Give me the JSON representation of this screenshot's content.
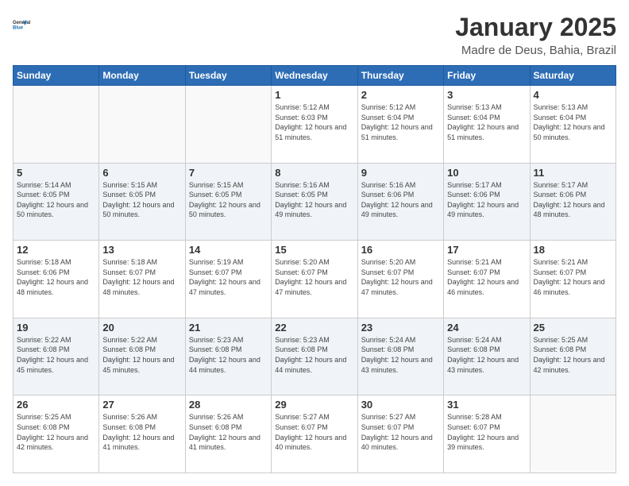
{
  "logo": {
    "line1": "General",
    "line2": "Blue"
  },
  "calendar": {
    "title": "January 2025",
    "subtitle": "Madre de Deus, Bahia, Brazil"
  },
  "headers": [
    "Sunday",
    "Monday",
    "Tuesday",
    "Wednesday",
    "Thursday",
    "Friday",
    "Saturday"
  ],
  "weeks": [
    {
      "shaded": false,
      "days": [
        {
          "num": "",
          "info": ""
        },
        {
          "num": "",
          "info": ""
        },
        {
          "num": "",
          "info": ""
        },
        {
          "num": "1",
          "info": "Sunrise: 5:12 AM\nSunset: 6:03 PM\nDaylight: 12 hours\nand 51 minutes."
        },
        {
          "num": "2",
          "info": "Sunrise: 5:12 AM\nSunset: 6:04 PM\nDaylight: 12 hours\nand 51 minutes."
        },
        {
          "num": "3",
          "info": "Sunrise: 5:13 AM\nSunset: 6:04 PM\nDaylight: 12 hours\nand 51 minutes."
        },
        {
          "num": "4",
          "info": "Sunrise: 5:13 AM\nSunset: 6:04 PM\nDaylight: 12 hours\nand 50 minutes."
        }
      ]
    },
    {
      "shaded": true,
      "days": [
        {
          "num": "5",
          "info": "Sunrise: 5:14 AM\nSunset: 6:05 PM\nDaylight: 12 hours\nand 50 minutes."
        },
        {
          "num": "6",
          "info": "Sunrise: 5:15 AM\nSunset: 6:05 PM\nDaylight: 12 hours\nand 50 minutes."
        },
        {
          "num": "7",
          "info": "Sunrise: 5:15 AM\nSunset: 6:05 PM\nDaylight: 12 hours\nand 50 minutes."
        },
        {
          "num": "8",
          "info": "Sunrise: 5:16 AM\nSunset: 6:05 PM\nDaylight: 12 hours\nand 49 minutes."
        },
        {
          "num": "9",
          "info": "Sunrise: 5:16 AM\nSunset: 6:06 PM\nDaylight: 12 hours\nand 49 minutes."
        },
        {
          "num": "10",
          "info": "Sunrise: 5:17 AM\nSunset: 6:06 PM\nDaylight: 12 hours\nand 49 minutes."
        },
        {
          "num": "11",
          "info": "Sunrise: 5:17 AM\nSunset: 6:06 PM\nDaylight: 12 hours\nand 48 minutes."
        }
      ]
    },
    {
      "shaded": false,
      "days": [
        {
          "num": "12",
          "info": "Sunrise: 5:18 AM\nSunset: 6:06 PM\nDaylight: 12 hours\nand 48 minutes."
        },
        {
          "num": "13",
          "info": "Sunrise: 5:18 AM\nSunset: 6:07 PM\nDaylight: 12 hours\nand 48 minutes."
        },
        {
          "num": "14",
          "info": "Sunrise: 5:19 AM\nSunset: 6:07 PM\nDaylight: 12 hours\nand 47 minutes."
        },
        {
          "num": "15",
          "info": "Sunrise: 5:20 AM\nSunset: 6:07 PM\nDaylight: 12 hours\nand 47 minutes."
        },
        {
          "num": "16",
          "info": "Sunrise: 5:20 AM\nSunset: 6:07 PM\nDaylight: 12 hours\nand 47 minutes."
        },
        {
          "num": "17",
          "info": "Sunrise: 5:21 AM\nSunset: 6:07 PM\nDaylight: 12 hours\nand 46 minutes."
        },
        {
          "num": "18",
          "info": "Sunrise: 5:21 AM\nSunset: 6:07 PM\nDaylight: 12 hours\nand 46 minutes."
        }
      ]
    },
    {
      "shaded": true,
      "days": [
        {
          "num": "19",
          "info": "Sunrise: 5:22 AM\nSunset: 6:08 PM\nDaylight: 12 hours\nand 45 minutes."
        },
        {
          "num": "20",
          "info": "Sunrise: 5:22 AM\nSunset: 6:08 PM\nDaylight: 12 hours\nand 45 minutes."
        },
        {
          "num": "21",
          "info": "Sunrise: 5:23 AM\nSunset: 6:08 PM\nDaylight: 12 hours\nand 44 minutes."
        },
        {
          "num": "22",
          "info": "Sunrise: 5:23 AM\nSunset: 6:08 PM\nDaylight: 12 hours\nand 44 minutes."
        },
        {
          "num": "23",
          "info": "Sunrise: 5:24 AM\nSunset: 6:08 PM\nDaylight: 12 hours\nand 43 minutes."
        },
        {
          "num": "24",
          "info": "Sunrise: 5:24 AM\nSunset: 6:08 PM\nDaylight: 12 hours\nand 43 minutes."
        },
        {
          "num": "25",
          "info": "Sunrise: 5:25 AM\nSunset: 6:08 PM\nDaylight: 12 hours\nand 42 minutes."
        }
      ]
    },
    {
      "shaded": false,
      "days": [
        {
          "num": "26",
          "info": "Sunrise: 5:25 AM\nSunset: 6:08 PM\nDaylight: 12 hours\nand 42 minutes."
        },
        {
          "num": "27",
          "info": "Sunrise: 5:26 AM\nSunset: 6:08 PM\nDaylight: 12 hours\nand 41 minutes."
        },
        {
          "num": "28",
          "info": "Sunrise: 5:26 AM\nSunset: 6:08 PM\nDaylight: 12 hours\nand 41 minutes."
        },
        {
          "num": "29",
          "info": "Sunrise: 5:27 AM\nSunset: 6:07 PM\nDaylight: 12 hours\nand 40 minutes."
        },
        {
          "num": "30",
          "info": "Sunrise: 5:27 AM\nSunset: 6:07 PM\nDaylight: 12 hours\nand 40 minutes."
        },
        {
          "num": "31",
          "info": "Sunrise: 5:28 AM\nSunset: 6:07 PM\nDaylight: 12 hours\nand 39 minutes."
        },
        {
          "num": "",
          "info": ""
        }
      ]
    }
  ]
}
